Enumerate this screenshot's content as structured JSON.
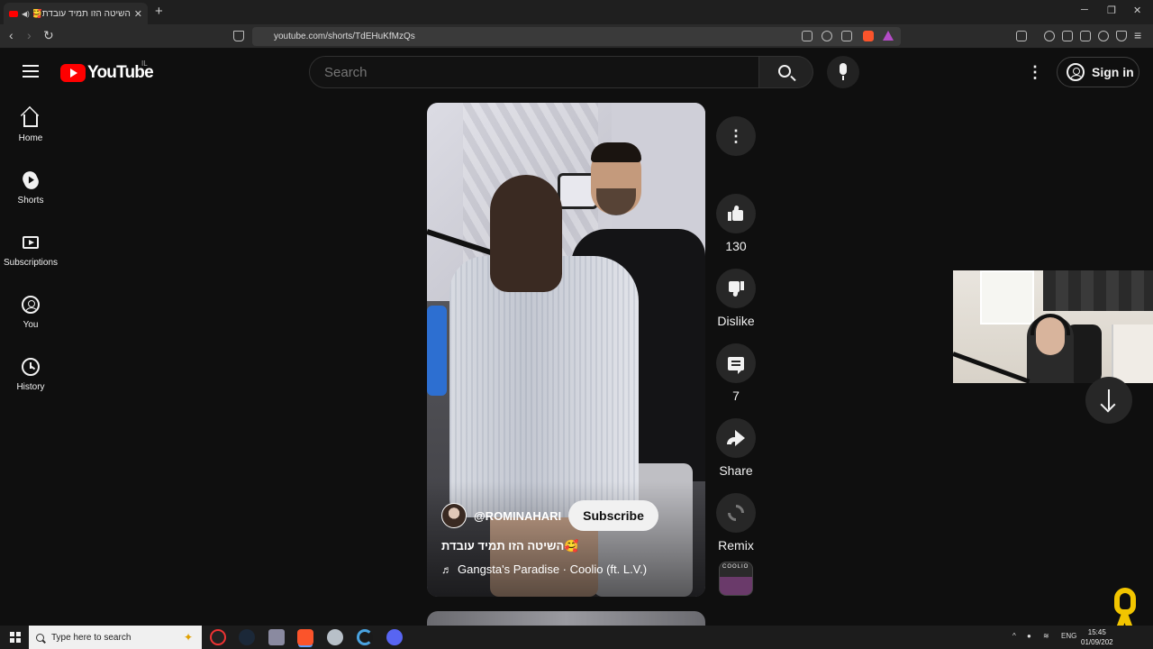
{
  "browser": {
    "tab_title": "השיטה הזו תמיד עובדת🥰 - ",
    "tab_close": "✕",
    "new_tab": "+",
    "url": "youtube.com/shorts/TdEHuKfMzQs",
    "window_controls": [
      "─",
      "❐",
      "✕"
    ]
  },
  "header": {
    "logo_text": "YouTube",
    "country_code": "IL",
    "search_placeholder": "Search",
    "signin_label": "Sign in",
    "more_glyph": "⋮"
  },
  "sidebar": {
    "items": [
      {
        "label": "Home",
        "icon": "home-icon"
      },
      {
        "label": "Shorts",
        "icon": "shorts-icon"
      },
      {
        "label": "Subscriptions",
        "icon": "subscriptions-icon"
      },
      {
        "label": "You",
        "icon": "you-icon"
      },
      {
        "label": "History",
        "icon": "history-icon"
      }
    ]
  },
  "short": {
    "channel_handle": "@ROMINAHARI",
    "subscribe_label": "Subscribe",
    "title": "השיטה הזו תמיד עובדת🥰",
    "music_note": "♬",
    "music": "Gangsta's Paradise · Coolio (ft. L.V.)"
  },
  "actions": {
    "more_glyph": "⋮",
    "like_count": "130",
    "dislike_label": "Dislike",
    "comment_count": "7",
    "share_label": "Share",
    "remix_label": "Remix",
    "audio_thumb_text": "COOLIO"
  },
  "taskbar": {
    "search_placeholder": "Type here to search",
    "lang": "ENG",
    "time": "15:45",
    "date": "01/09/202"
  },
  "colors": {
    "background": "#0f0f0f",
    "brand_red": "#ff0000",
    "ribbon_yellow": "#f2c500"
  }
}
